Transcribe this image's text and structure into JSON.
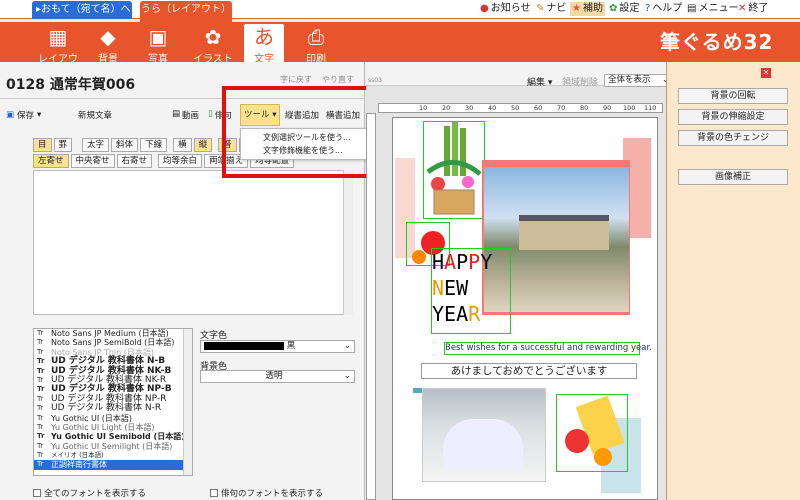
{
  "tabs": {
    "front": "▸おもて（宛て名）へ切替",
    "back": "うら（レイアウト）"
  },
  "topmenu": [
    "お知らせ",
    "ナビ",
    "補助",
    "設定",
    "ヘルプ",
    "メニュー",
    "終了"
  ],
  "toolbar": [
    {
      "label": "レイアウト",
      "icon": "layout-icon"
    },
    {
      "label": "背景",
      "icon": "background-icon"
    },
    {
      "label": "写真",
      "icon": "photo-icon"
    },
    {
      "label": "イラスト",
      "icon": "illustration-icon"
    },
    {
      "label": "文字",
      "icon": "text-icon"
    },
    {
      "label": "印刷",
      "icon": "print-icon"
    }
  ],
  "brand": "筆ぐるめ32",
  "doc_title": "0128 通常年賀006",
  "top_hint1": "字に戻す",
  "top_hint2": "やり直す",
  "file_actions": {
    "save": "保存",
    "new_text": "新規文章",
    "animation": "動画",
    "haiku": "俳句",
    "tool": "ツール",
    "add_vertical": "縦書追加",
    "add_horizontal": "横書追加"
  },
  "fmt_row1": [
    "目",
    "罫",
    "太字",
    "斜体",
    "下線",
    "横",
    "縦",
    "普",
    "住",
    "名"
  ],
  "fmt_row2": [
    "左寄せ",
    "中央寄せ",
    "右寄せ",
    "均等余白",
    "両端揃え",
    "均等配置"
  ],
  "dropdown": [
    "文例選択ツールを使う...",
    "文字修飾機能を使う..."
  ],
  "font_list": [
    "Noto Sans JP Medium (日本語)",
    "Noto Sans JP SemiBold (日本語)",
    "Noto Sans JP Thin (日本語)",
    "UD デジタル 教科書体 N-B",
    "UD デジタル 教科書体 NK-B",
    "UD デジタル 教科書体 NK-R",
    "UD デジタル 教科書体 NP-B",
    "UD デジタル 教科書体 NP-R",
    "UD デジタル 教科書体 N-R",
    "Yu Gothic UI (日本語)",
    "Yu Gothic UI Light (日本語)",
    "Yu Gothic UI Semibold (日本語)",
    "Yu Gothic UI Semilight (日本語)",
    "メイリオ (日本語)",
    "正調祥南行書体"
  ],
  "text_color_label": "文字色",
  "text_color_value": "黒",
  "bg_color_label": "背景色",
  "bg_color_value": "透明",
  "show_all_fonts": "全てのフォントを表示する",
  "show_haiku_fonts": "俳句のフォントを表示する",
  "editor": {
    "label1": "編集",
    "label2": "領域削除",
    "view": "全体を表示"
  },
  "ruler_ticks": [
    "10",
    "20",
    "30",
    "40",
    "50",
    "60",
    "70",
    "80",
    "90",
    "100",
    "110"
  ],
  "card": {
    "happy": [
      "H",
      "A",
      "P",
      "P",
      "Y"
    ],
    "new": [
      "N",
      "E",
      "W"
    ],
    "year": [
      "Y",
      "E",
      "A",
      "R"
    ],
    "english_msg": "Best wishes for a successful and rewarding year.",
    "japanese_msg": "あけましておめでとうございます"
  },
  "right_buttons": [
    "背景の回転",
    "背景の伸縮設定",
    "背景の色チェンジ",
    "画像補正"
  ],
  "colors": {
    "accent": "#e8542c",
    "highlight": "#e01010",
    "tab_blue": "#2a6bd6"
  }
}
